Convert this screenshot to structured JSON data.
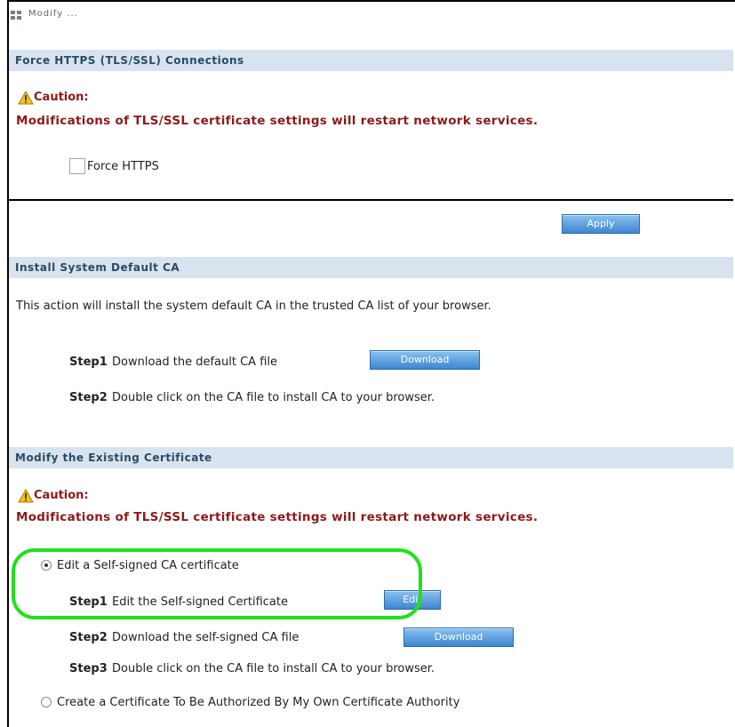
{
  "window": {
    "title": "Modify ... ",
    "icon": "window-icon"
  },
  "sections": {
    "https": {
      "header": "Force HTTPS (TLS/SSL) Connections",
      "caution_title": "Caution:",
      "caution_text": "Modifications of TLS/SSL certificate settings will restart network services.",
      "checkbox_label": "Force HTTPS",
      "checkbox_checked": false,
      "apply_label": "Apply"
    },
    "install_ca": {
      "header": "Install System Default CA",
      "description": "This action will install the system default CA in the trusted CA list of your browser.",
      "step1_label": "Step1",
      "step1_text": "Download the default CA file",
      "download_label": "Download",
      "step2_label": "Step2",
      "step2_text": "Double click on the CA file to install CA to your browser."
    },
    "modify_cert": {
      "header": "Modify the Existing Certificate",
      "caution_title": "Caution:",
      "caution_text": "Modifications of TLS/SSL certificate settings will restart network services.",
      "option1_label": "Edit a Self-signed CA certificate",
      "option1_selected": true,
      "step1_label": "Step1",
      "step1_text": "Edit the Self-signed Certificate",
      "edit_label": "Edit",
      "step2_label": "Step2",
      "step2_text": "Download the self-signed CA file",
      "download_label": "Download",
      "step3_label": "Step3",
      "step3_text": "Double click on the CA file to install CA to your browser.",
      "option2_label": "Create a Certificate To Be Authorized By My Own Certificate Authority",
      "option2_selected": false
    }
  },
  "colors": {
    "header_bg": "#d7e3ee",
    "header_text": "#2b4a66",
    "caution": "#8b1a1a",
    "button_blue": "#3d86cf",
    "highlight": "#22e01a"
  }
}
